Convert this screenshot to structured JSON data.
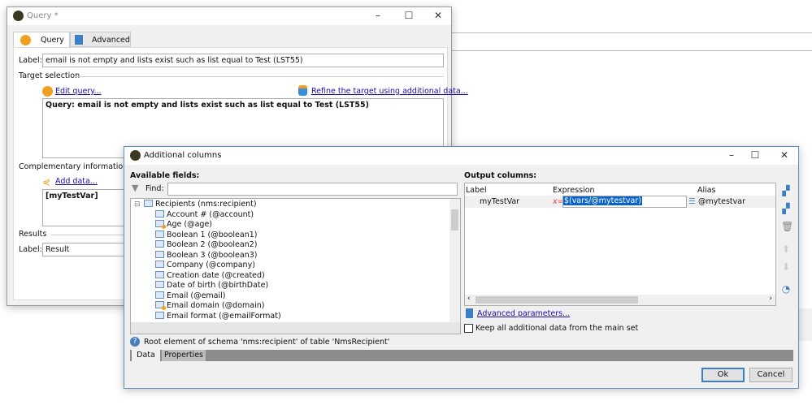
{
  "query_window": {
    "title": "Query *",
    "tabs": [
      {
        "label": "Query",
        "active": true
      },
      {
        "label": "Advanced",
        "active": false
      }
    ],
    "label_caption": "Label:",
    "label_value": "email is not empty and lists exist such as list equal to Test (LST55)",
    "target_selection": "Target selection",
    "edit_query": "Edit query...",
    "refine_target": "Refine the target using additional data...",
    "query_text": "Query: email is not empty and lists exist such as list equal to Test (LST55)",
    "complementary_information": "Complementary information",
    "add_data": "Add data...",
    "complementary_text": "[myTestVar]",
    "results": "Results",
    "results_label_caption": "Label:",
    "results_label_value": "Result"
  },
  "additional_columns": {
    "title": "Additional columns",
    "available_fields": "Available fields:",
    "find_label": "Find:",
    "find_value": "",
    "tree_root": "Recipients (nms:recipient)",
    "tree_items": [
      {
        "label": "Account # (@account)",
        "calculated": false
      },
      {
        "label": "Age (@age)",
        "calculated": true
      },
      {
        "label": "Boolean 1 (@boolean1)",
        "calculated": false
      },
      {
        "label": "Boolean 2 (@boolean2)",
        "calculated": false
      },
      {
        "label": "Boolean 3 (@boolean3)",
        "calculated": false
      },
      {
        "label": "Company (@company)",
        "calculated": false
      },
      {
        "label": "Creation date (@created)",
        "calculated": false
      },
      {
        "label": "Date of birth (@birthDate)",
        "calculated": false
      },
      {
        "label": "Email (@email)",
        "calculated": false
      },
      {
        "label": "Email domain (@domain)",
        "calculated": true
      },
      {
        "label": "Email format (@emailFormat)",
        "calculated": false
      }
    ],
    "info_text": "Root element of schema 'nms:recipient' of table 'NmsRecipient'",
    "bottom_tabs": [
      "Data",
      "Properties"
    ],
    "output_columns": "Output columns:",
    "columns": [
      "Label",
      "Expression",
      "Alias"
    ],
    "rows": [
      {
        "label": "myTestVar",
        "expression_prefix": "x=",
        "expression": "$(vars/@mytestvar)",
        "alias": "@mytestvar"
      }
    ],
    "advanced_parameters": "Advanced parameters...",
    "keep_all": "Keep all additional data from the main set",
    "keep_all_checked": false,
    "ok": "Ok",
    "cancel": "Cancel"
  }
}
